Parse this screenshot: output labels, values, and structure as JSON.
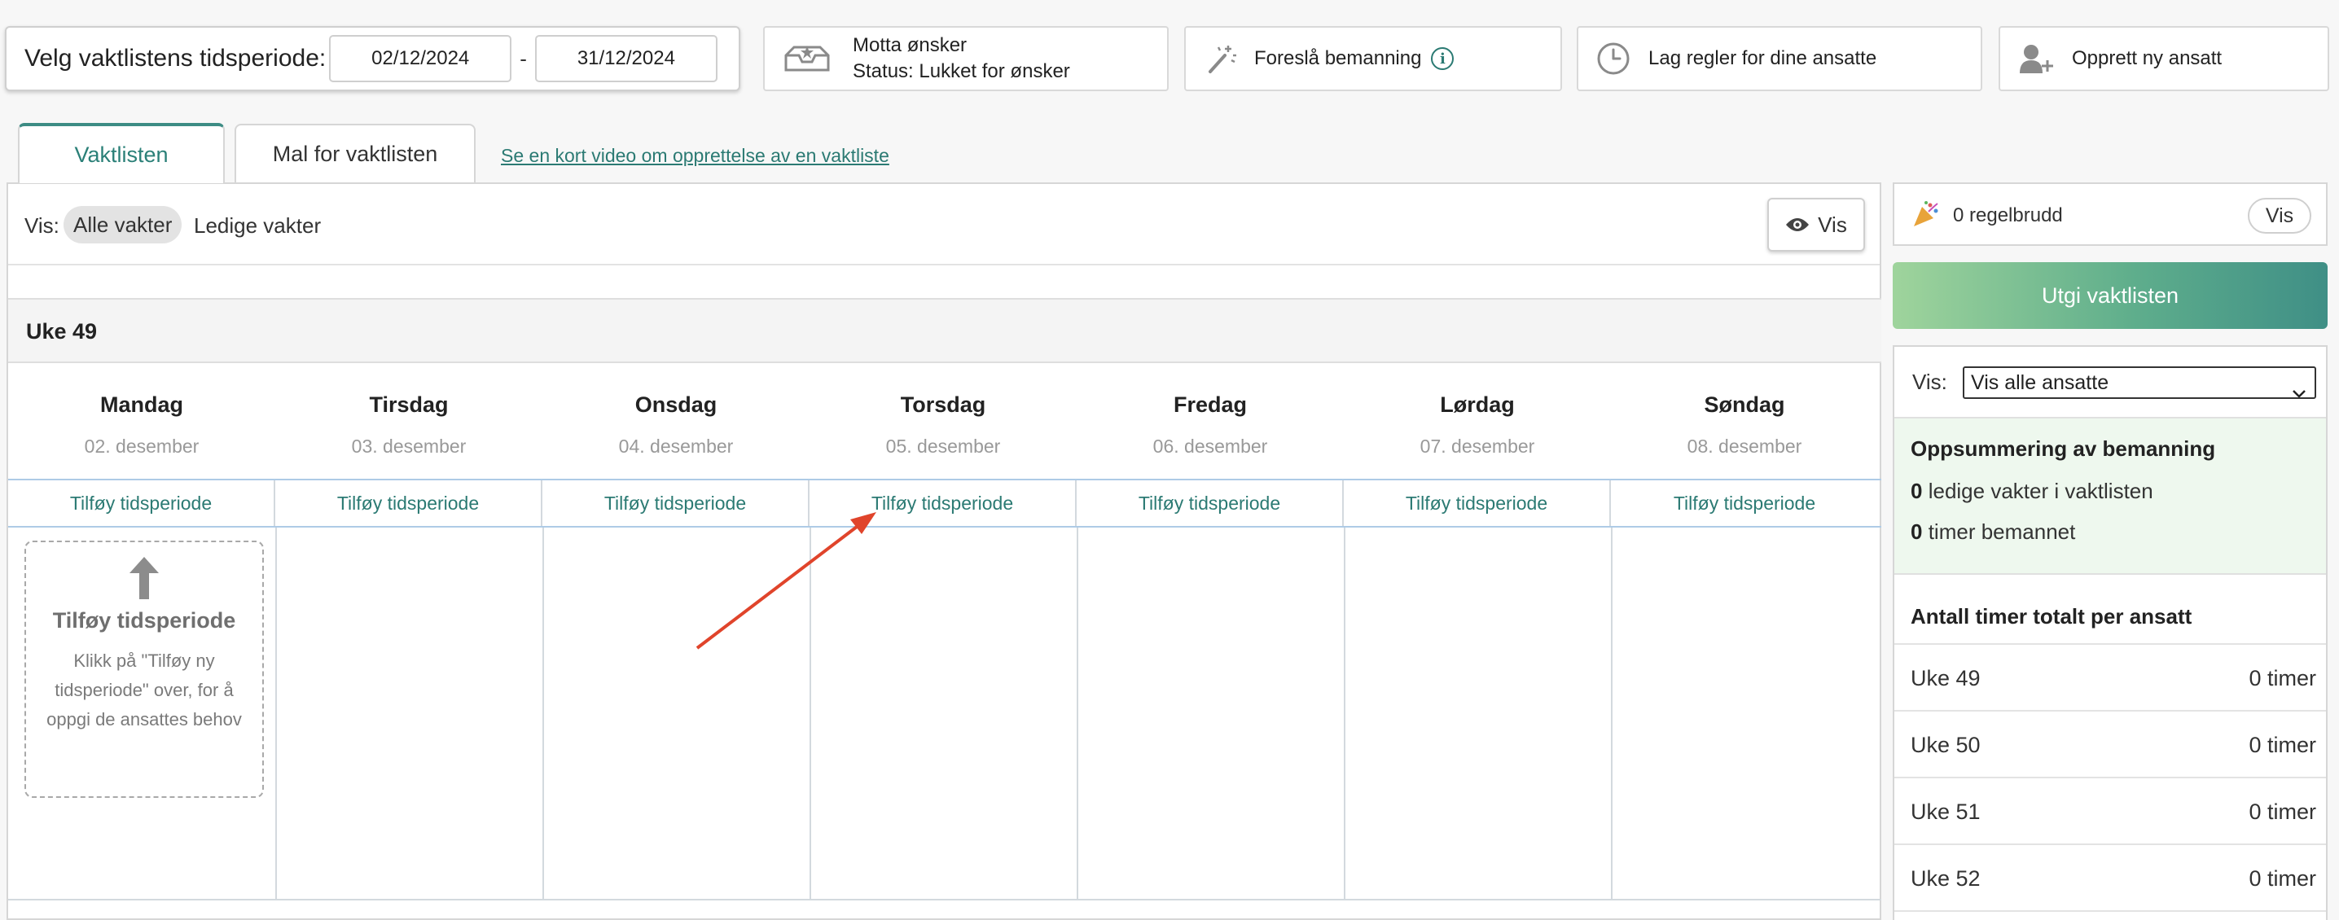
{
  "toolbar": {
    "period_label": "Velg vaktlistens tidsperiode:",
    "date_from": "02/12/2024",
    "date_separator": "-",
    "date_to": "31/12/2024",
    "wishes_title": "Motta ønsker",
    "wishes_status": "Status: Lukket for ønsker",
    "suggest_label": "Foreslå bemanning",
    "rules_label": "Lag regler for dine ansatte",
    "new_employee_label": "Opprett ny ansatt"
  },
  "tabs": [
    {
      "label": "Vaktlisten",
      "active": true
    },
    {
      "label": "Mal for vaktlisten",
      "active": false
    }
  ],
  "video_link": "Se en kort video om opprettelse av en vaktliste",
  "filter": {
    "label": "Vis:",
    "all_shifts": "Alle vakter",
    "free_shifts": "Ledige vakter",
    "view_button": "Vis"
  },
  "week": {
    "title": "Uke 49",
    "add_label": "Tilføy tidsperiode",
    "days": [
      {
        "name": "Mandag",
        "date": "02. desember"
      },
      {
        "name": "Tirsdag",
        "date": "03. desember"
      },
      {
        "name": "Onsdag",
        "date": "04. desember"
      },
      {
        "name": "Torsdag",
        "date": "05. desember"
      },
      {
        "name": "Fredag",
        "date": "06. desember"
      },
      {
        "name": "Lørdag",
        "date": "07. desember"
      },
      {
        "name": "Søndag",
        "date": "08. desember"
      }
    ]
  },
  "hint": {
    "title": "Tilføy tidsperiode",
    "text": "Klikk på \"Tilføy ny tidsperiode\" over, for å oppgi de ansattes behov"
  },
  "sidebar": {
    "rule_breaks": "0 regelbrudd",
    "rule_view": "Vis",
    "publish": "Utgi vaktlisten",
    "vis_label": "Vis:",
    "employee_filter": "Vis alle ansatte",
    "summary_title": "Oppsummering av bemanning",
    "free_count": "0",
    "free_text": "ledige vakter i vaktlisten",
    "hours_count": "0",
    "hours_text": "timer bemannet",
    "total_title": "Antall timer totalt per ansatt",
    "weeks": [
      {
        "name": "Uke 49",
        "hours": "0 timer"
      },
      {
        "name": "Uke 50",
        "hours": "0 timer"
      },
      {
        "name": "Uke 51",
        "hours": "0 timer"
      },
      {
        "name": "Uke 52",
        "hours": "0 timer"
      }
    ]
  },
  "colors": {
    "accent": "#2b7a73",
    "publish_start": "#9fd49c",
    "publish_end": "#3f8f86",
    "annotation_arrow": "#e0442b"
  }
}
